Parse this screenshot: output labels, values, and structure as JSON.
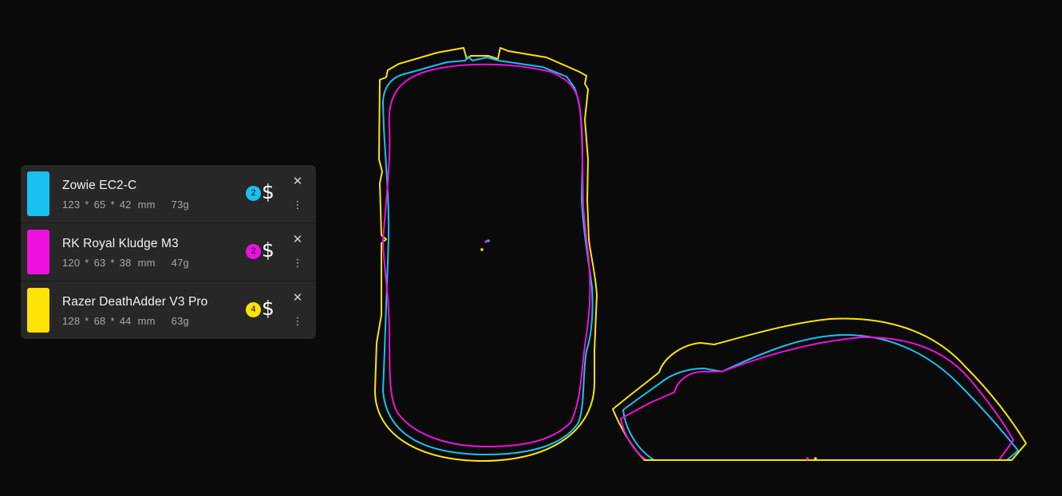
{
  "mice": [
    {
      "name": "Zowie EC2-C",
      "length": "123",
      "width": "65",
      "height": "42",
      "unit": "mm",
      "weight": "73g",
      "price_tier": "2",
      "price_symbol": "$",
      "color": "#19c1f0"
    },
    {
      "name": "RK Royal Kludge M3",
      "length": "120",
      "width": "63",
      "height": "38",
      "unit": "mm",
      "weight": "47g",
      "price_tier": "2",
      "price_symbol": "$",
      "color": "#ee10dd"
    },
    {
      "name": "Razer DeathAdder V3 Pro",
      "length": "128",
      "width": "68",
      "height": "44",
      "unit": "mm",
      "weight": "63g",
      "price_tier": "4",
      "price_symbol": "$",
      "color": "#fde306"
    }
  ],
  "dim_separator": "*",
  "icons": {
    "close": "close-icon",
    "more": "more-vert-icon",
    "price": "dollar-icon"
  },
  "background_color": "#0a0a0a",
  "panel_color": "#272727"
}
